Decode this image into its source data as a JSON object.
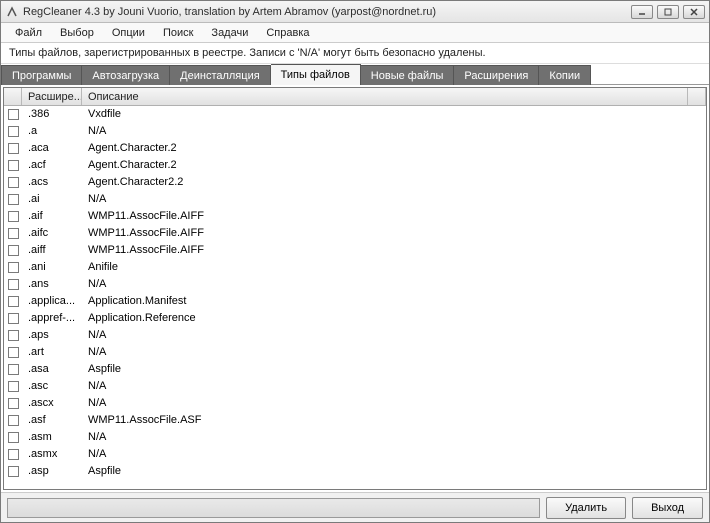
{
  "window": {
    "title": "RegCleaner 4.3 by Jouni Vuorio, translation by Artem Abramov (yarpost@nordnet.ru)"
  },
  "menu": {
    "items": [
      "Файл",
      "Выбор",
      "Опции",
      "Поиск",
      "Задачи",
      "Справка"
    ]
  },
  "info_text": "Типы файлов, зарегистрированных в реестре. Записи с 'N/A' могут быть безопасно удалены.",
  "tabs": {
    "items": [
      "Программы",
      "Автозагрузка",
      "Деинсталляция",
      "Типы файлов",
      "Новые файлы",
      "Расширения",
      "Копии"
    ],
    "active_index": 3
  },
  "columns": {
    "ext": "Расшире...",
    "desc": "Описание"
  },
  "rows": [
    {
      "ext": ".386",
      "desc": "Vxdfile"
    },
    {
      "ext": ".a",
      "desc": "N/A"
    },
    {
      "ext": ".aca",
      "desc": "Agent.Character.2"
    },
    {
      "ext": ".acf",
      "desc": "Agent.Character.2"
    },
    {
      "ext": ".acs",
      "desc": "Agent.Character2.2"
    },
    {
      "ext": ".ai",
      "desc": "N/A"
    },
    {
      "ext": ".aif",
      "desc": "WMP11.AssocFile.AIFF"
    },
    {
      "ext": ".aifc",
      "desc": "WMP11.AssocFile.AIFF"
    },
    {
      "ext": ".aiff",
      "desc": "WMP11.AssocFile.AIFF"
    },
    {
      "ext": ".ani",
      "desc": "Anifile"
    },
    {
      "ext": ".ans",
      "desc": "N/A"
    },
    {
      "ext": ".applica...",
      "desc": "Application.Manifest"
    },
    {
      "ext": ".appref-...",
      "desc": "Application.Reference"
    },
    {
      "ext": ".aps",
      "desc": "N/A"
    },
    {
      "ext": ".art",
      "desc": "N/A"
    },
    {
      "ext": ".asa",
      "desc": "Aspfile"
    },
    {
      "ext": ".asc",
      "desc": "N/A"
    },
    {
      "ext": ".ascx",
      "desc": "N/A"
    },
    {
      "ext": ".asf",
      "desc": "WMP11.AssocFile.ASF"
    },
    {
      "ext": ".asm",
      "desc": "N/A"
    },
    {
      "ext": ".asmx",
      "desc": "N/A"
    },
    {
      "ext": ".asp",
      "desc": "Aspfile"
    }
  ],
  "buttons": {
    "delete": "Удалить",
    "exit": "Выход"
  }
}
